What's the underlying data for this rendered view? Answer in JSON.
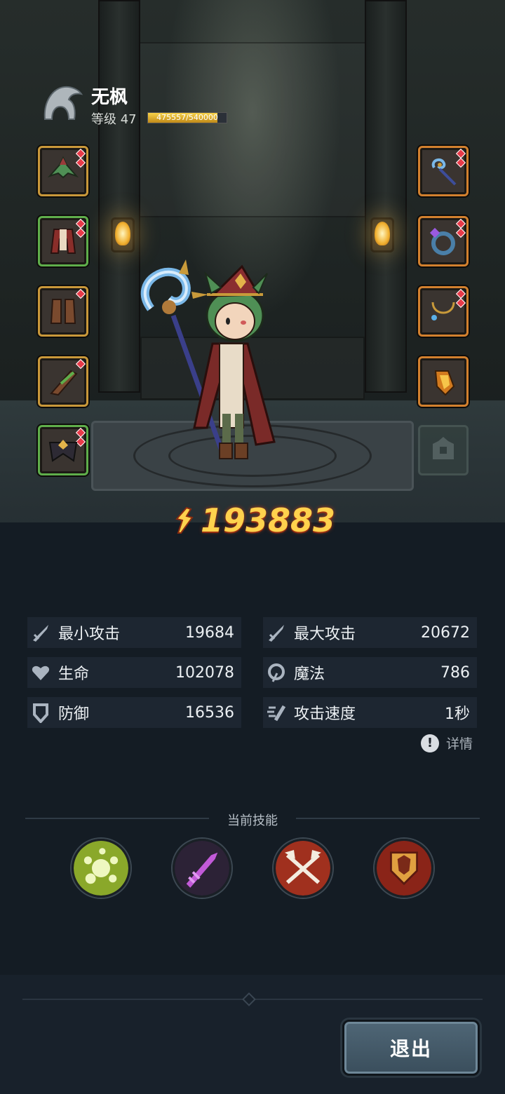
{
  "player": {
    "name": "无枫",
    "level_label": "等级 47",
    "exp_text": "475557/540000",
    "exp_fraction": 0.8807
  },
  "equipment": {
    "left": [
      {
        "name": "hat",
        "rarity": "gold"
      },
      {
        "name": "robe",
        "rarity": "green"
      },
      {
        "name": "boots",
        "rarity": "gold"
      },
      {
        "name": "bracer",
        "rarity": "gold"
      },
      {
        "name": "belt",
        "rarity": "green"
      }
    ],
    "right": [
      {
        "name": "staff",
        "rarity": "orange"
      },
      {
        "name": "ring",
        "rarity": "orange"
      },
      {
        "name": "necklace",
        "rarity": "orange"
      },
      {
        "name": "charm",
        "rarity": "orange"
      }
    ]
  },
  "power": {
    "value": "193883"
  },
  "stats": [
    {
      "label": "最小攻击",
      "value": "19684",
      "icon": "sword-icon"
    },
    {
      "label": "最大攻击",
      "value": "20672",
      "icon": "sword-icon"
    },
    {
      "label": "生命",
      "value": "102078",
      "icon": "heart-icon"
    },
    {
      "label": "魔法",
      "value": "786",
      "icon": "magic-icon"
    },
    {
      "label": "防御",
      "value": "16536",
      "icon": "shield-icon"
    },
    {
      "label": "攻击速度",
      "value": "1秒",
      "icon": "speed-icon"
    }
  ],
  "details": {
    "icon": "!",
    "label": "详情"
  },
  "skills": {
    "title": "当前技能",
    "items": [
      "poison-orbs-skill",
      "shadow-blade-skill",
      "dual-axes-skill",
      "guardian-shield-skill"
    ]
  },
  "footer": {
    "exit_label": "退出"
  }
}
